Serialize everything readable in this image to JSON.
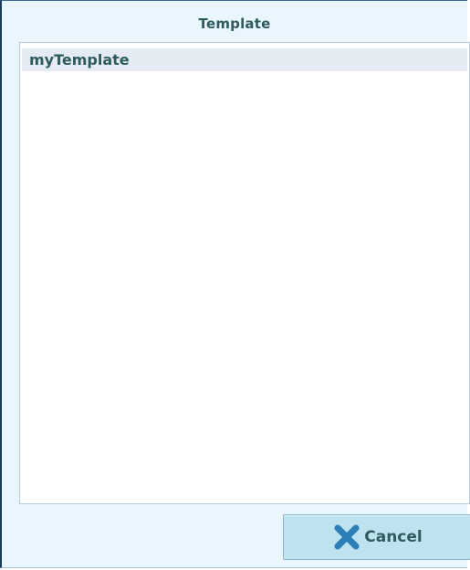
{
  "dialog": {
    "title": "Template"
  },
  "template_list": {
    "items": [
      {
        "label": "myTemplate",
        "selected": true
      }
    ]
  },
  "actions": {
    "cancel_label": "Cancel",
    "cancel_icon": "close-icon"
  },
  "colors": {
    "background": "#eaf6fd",
    "text": "#2e5b5f",
    "button": "#bfe3ee",
    "selected_row": "#e4ebf2",
    "icon": "#2d7fb8"
  }
}
